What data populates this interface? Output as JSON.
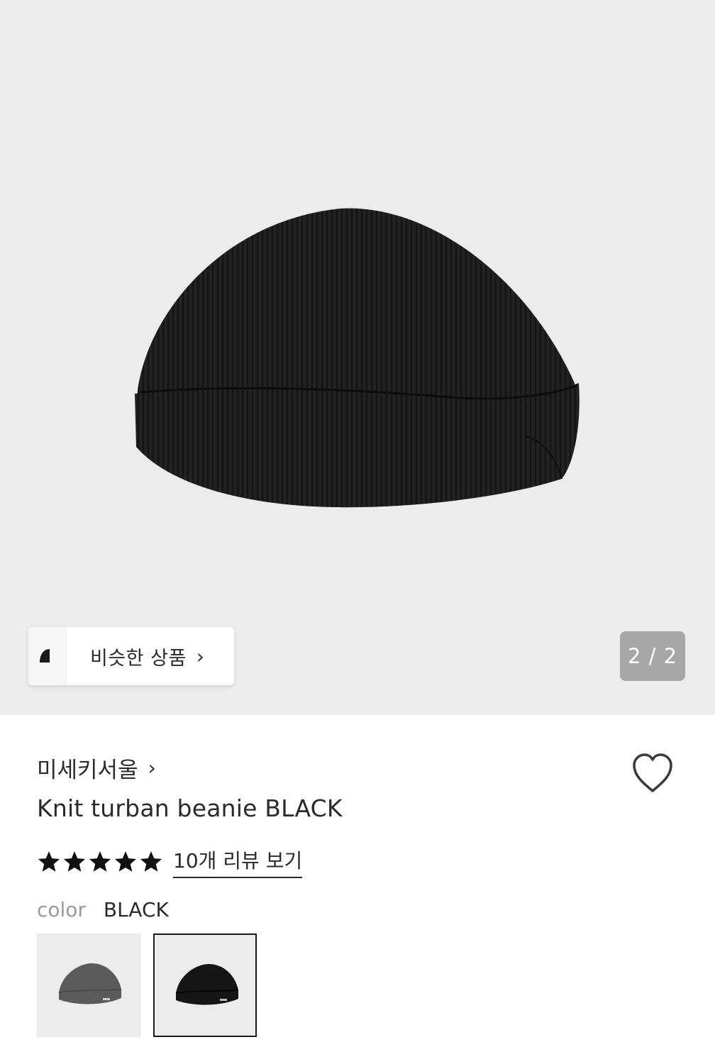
{
  "hero": {
    "image_icon": "knit-turban-beanie-black",
    "background": "#ececec",
    "page_counter": "2 / 2"
  },
  "similar": {
    "label": "비슷한 상품",
    "chevron": "›"
  },
  "brand": {
    "name": "미세키서울",
    "chevron": "›"
  },
  "product": {
    "name": "Knit turban beanie BLACK",
    "rating_stars": 5,
    "review_link": "10개 리뷰 보기",
    "wishlist_icon": "heart-outline-icon"
  },
  "color": {
    "label": "color",
    "selected": "BLACK",
    "options": [
      {
        "icon": "grey-beanie-thumbnail",
        "hex": "#5a5a5a"
      },
      {
        "icon": "black-beanie-thumbnail",
        "hex": "#151515"
      }
    ]
  }
}
